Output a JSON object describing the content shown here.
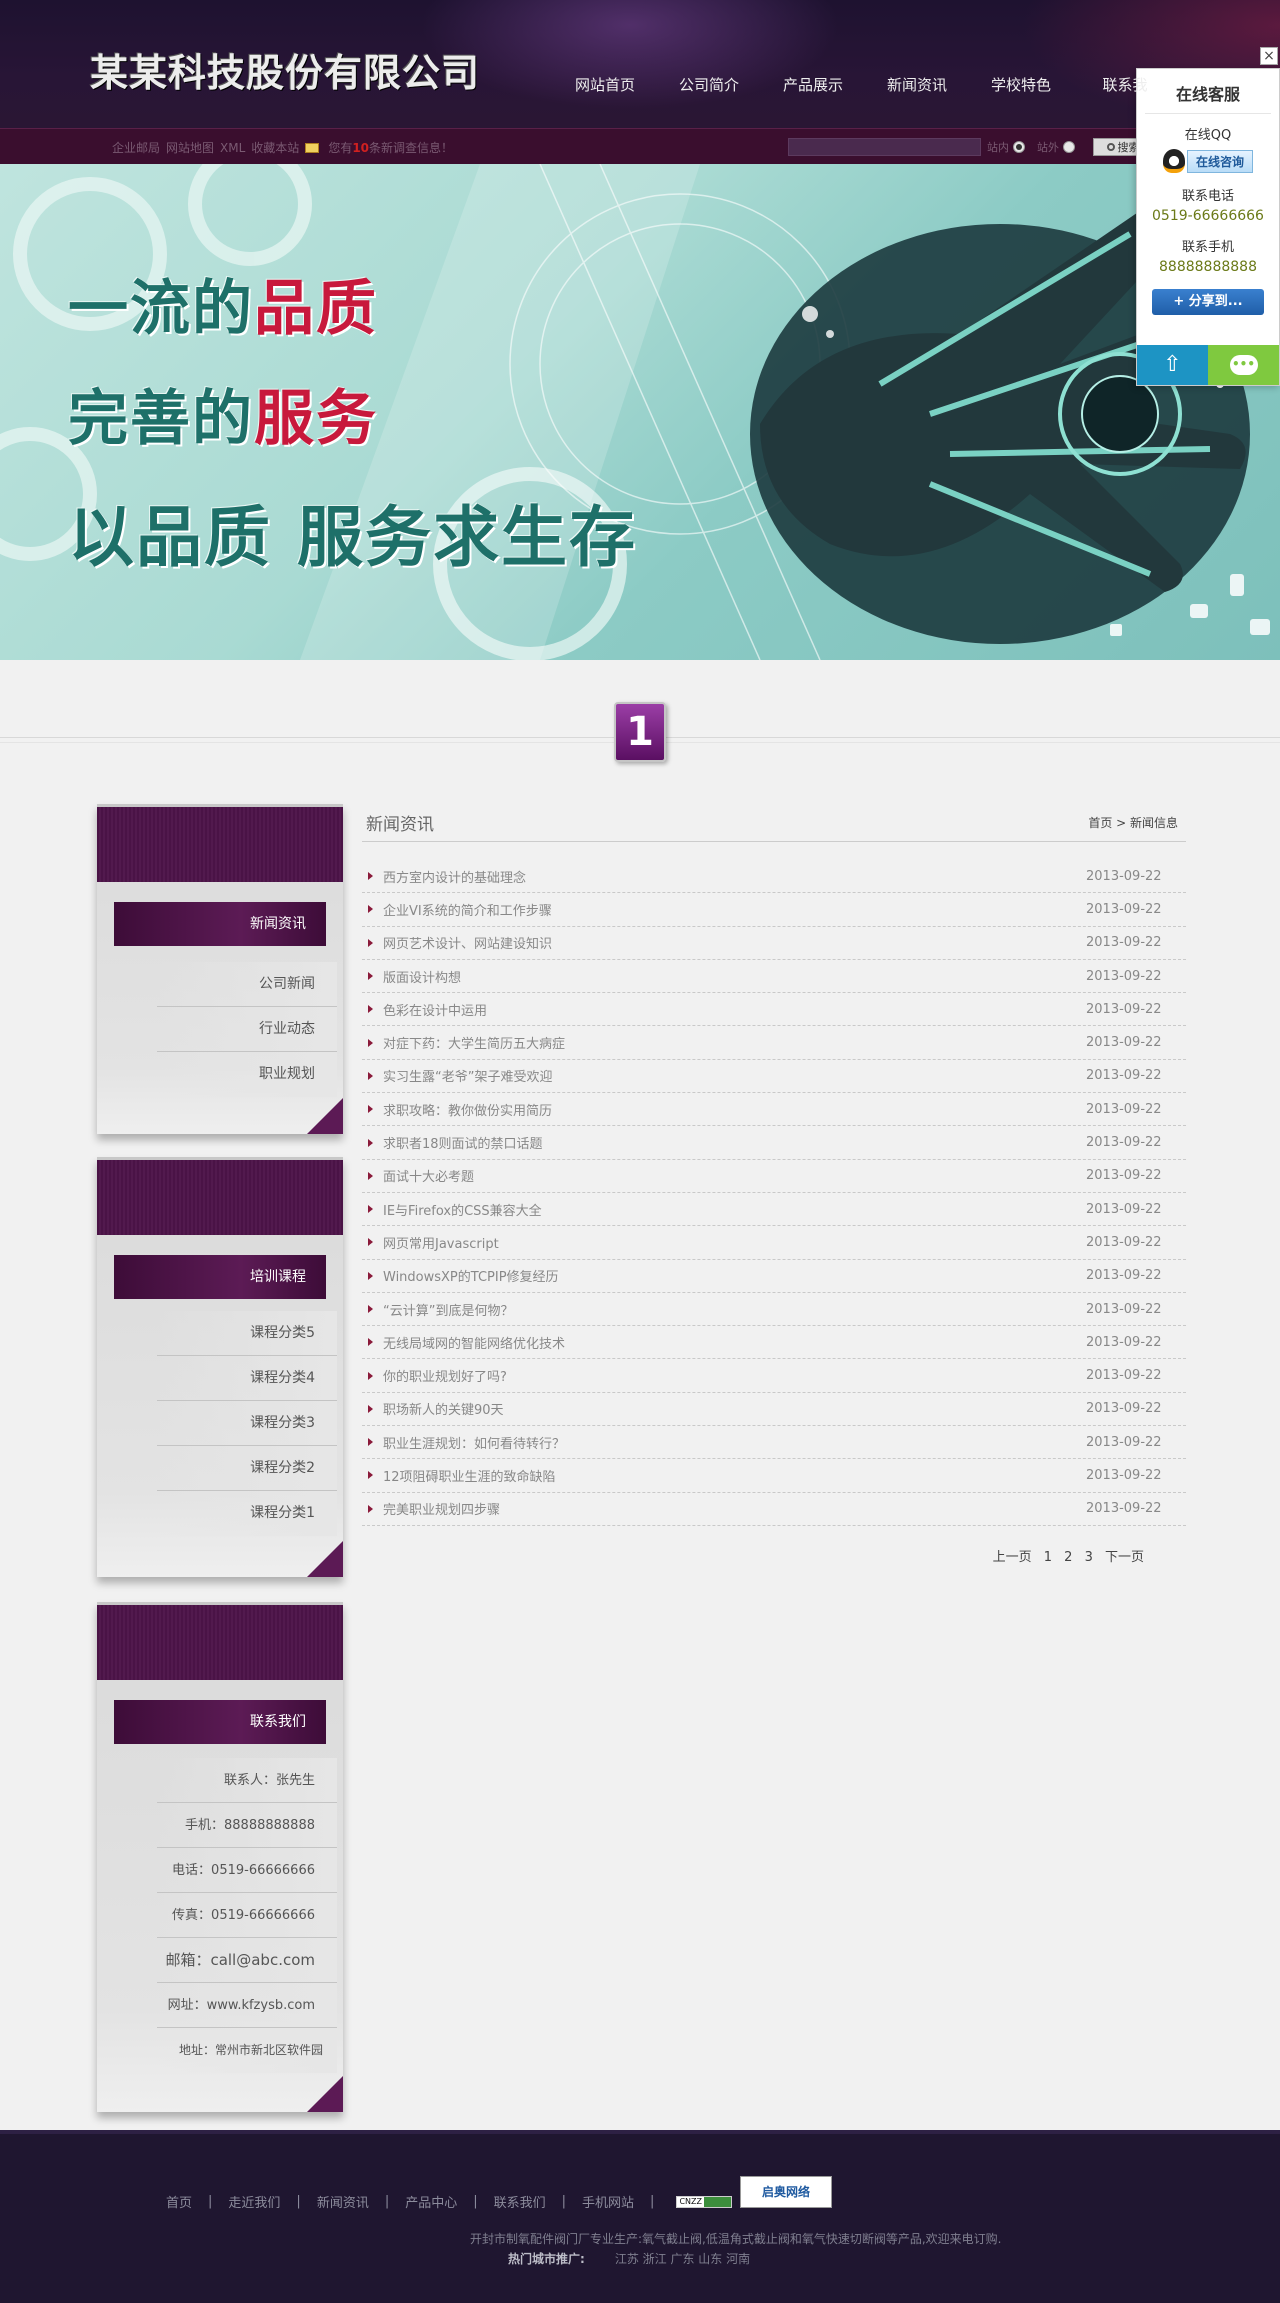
{
  "header": {
    "logo": "某某科技股份有限公司",
    "nav": [
      "网站首页",
      "公司简介",
      "产品展示",
      "新闻资讯",
      "学校特色",
      "联系我"
    ]
  },
  "subbar": {
    "links": [
      "企业邮局",
      "网站地图",
      "XML",
      "收藏本站"
    ],
    "notice_prefix": "您有",
    "notice_num": "10",
    "notice_suffix": "条新调查信息！",
    "search_placeholder": "",
    "radio_in": "站内",
    "radio_out": "站外",
    "search_btn": "搜索"
  },
  "banner": {
    "line1_a": "一流的",
    "line1_b": "品质",
    "line2_a": "完善的",
    "line2_b": "服务",
    "line3": "以品质  服务求生存"
  },
  "section_badge": "1",
  "sidebar": {
    "news": {
      "title": "新闻资讯",
      "items": [
        "公司新闻",
        "行业动态",
        "职业规划"
      ]
    },
    "courses": {
      "title": "培训课程",
      "items": [
        "课程分类5",
        "课程分类4",
        "课程分类3",
        "课程分类2",
        "课程分类1"
      ]
    },
    "contact": {
      "title": "联系我们",
      "items": [
        "联系人：张先生",
        "手机：88888888888",
        "电话：0519-66666666",
        "传真：0519-66666666",
        "邮箱：call@abc.com",
        "网址：www.kfzysb.com",
        "地址：常州市新北区软件园"
      ]
    }
  },
  "main": {
    "title": "新闻资讯",
    "breadcrumb": "首页 > 新闻信息",
    "news": [
      {
        "title": "西方室内设计的基础理念",
        "date": "2013-09-22"
      },
      {
        "title": "企业VI系统的简介和工作步骤",
        "date": "2013-09-22"
      },
      {
        "title": "网页艺术设计、网站建设知识",
        "date": "2013-09-22"
      },
      {
        "title": "版面设计构想",
        "date": "2013-09-22"
      },
      {
        "title": "色彩在设计中运用",
        "date": "2013-09-22"
      },
      {
        "title": "对症下药：大学生简历五大病症",
        "date": "2013-09-22"
      },
      {
        "title": "实习生露“老爷”架子难受欢迎",
        "date": "2013-09-22"
      },
      {
        "title": "求职攻略：教你做份实用简历",
        "date": "2013-09-22"
      },
      {
        "title": "求职者18则面试的禁口话题",
        "date": "2013-09-22"
      },
      {
        "title": "面试十大必考题",
        "date": "2013-09-22"
      },
      {
        "title": "IE与Firefox的CSS兼容大全",
        "date": "2013-09-22"
      },
      {
        "title": "网页常用Javascript",
        "date": "2013-09-22"
      },
      {
        "title": "WindowsXP的TCPIP修复经历",
        "date": "2013-09-22"
      },
      {
        "title": "“云计算”到底是何物？",
        "date": "2013-09-22"
      },
      {
        "title": "无线局域网的智能网络优化技术",
        "date": "2013-09-22"
      },
      {
        "title": "你的职业规划好了吗?",
        "date": "2013-09-22"
      },
      {
        "title": "职场新人的关键90天",
        "date": "2013-09-22"
      },
      {
        "title": "职业生涯规划：如何看待转行？",
        "date": "2013-09-22"
      },
      {
        "title": "12项阻碍职业生涯的致命缺陷",
        "date": "2013-09-22"
      },
      {
        "title": "完美职业规划四步骤",
        "date": "2013-09-22"
      }
    ],
    "pager": {
      "prev": "上一页",
      "pages": [
        "1",
        "2",
        "3"
      ],
      "next": "下一页"
    }
  },
  "float_service": {
    "close": "×",
    "title": "在线客服",
    "qq_label": "在线QQ",
    "qq_btn": "在线咨询",
    "phone_label": "联系电话",
    "phone": "0519-66666666",
    "mobile_label": "联系手机",
    "mobile": "88888888888",
    "share": "分享到...",
    "top_icon": "arrow-up-icon",
    "chat_icon": "chat-bubble-icon"
  },
  "footer": {
    "links": [
      "首页",
      "|",
      "走近我们",
      "|",
      "新闻资讯",
      "|",
      "产品中心",
      "|",
      "联系我们",
      "|",
      "手机网站",
      "|"
    ],
    "cnzz": "CNZZ",
    "zoom_logo": "启奥网络",
    "desc": "开封市制氧配件阀门厂专业生产:氧气截止阀,低温角式截止阀和氧气快速切断阀等产品,欢迎来电订购.",
    "hot_label": "热门城市推广:",
    "hot_cities": "江苏 浙江 广东 山东 河南"
  }
}
